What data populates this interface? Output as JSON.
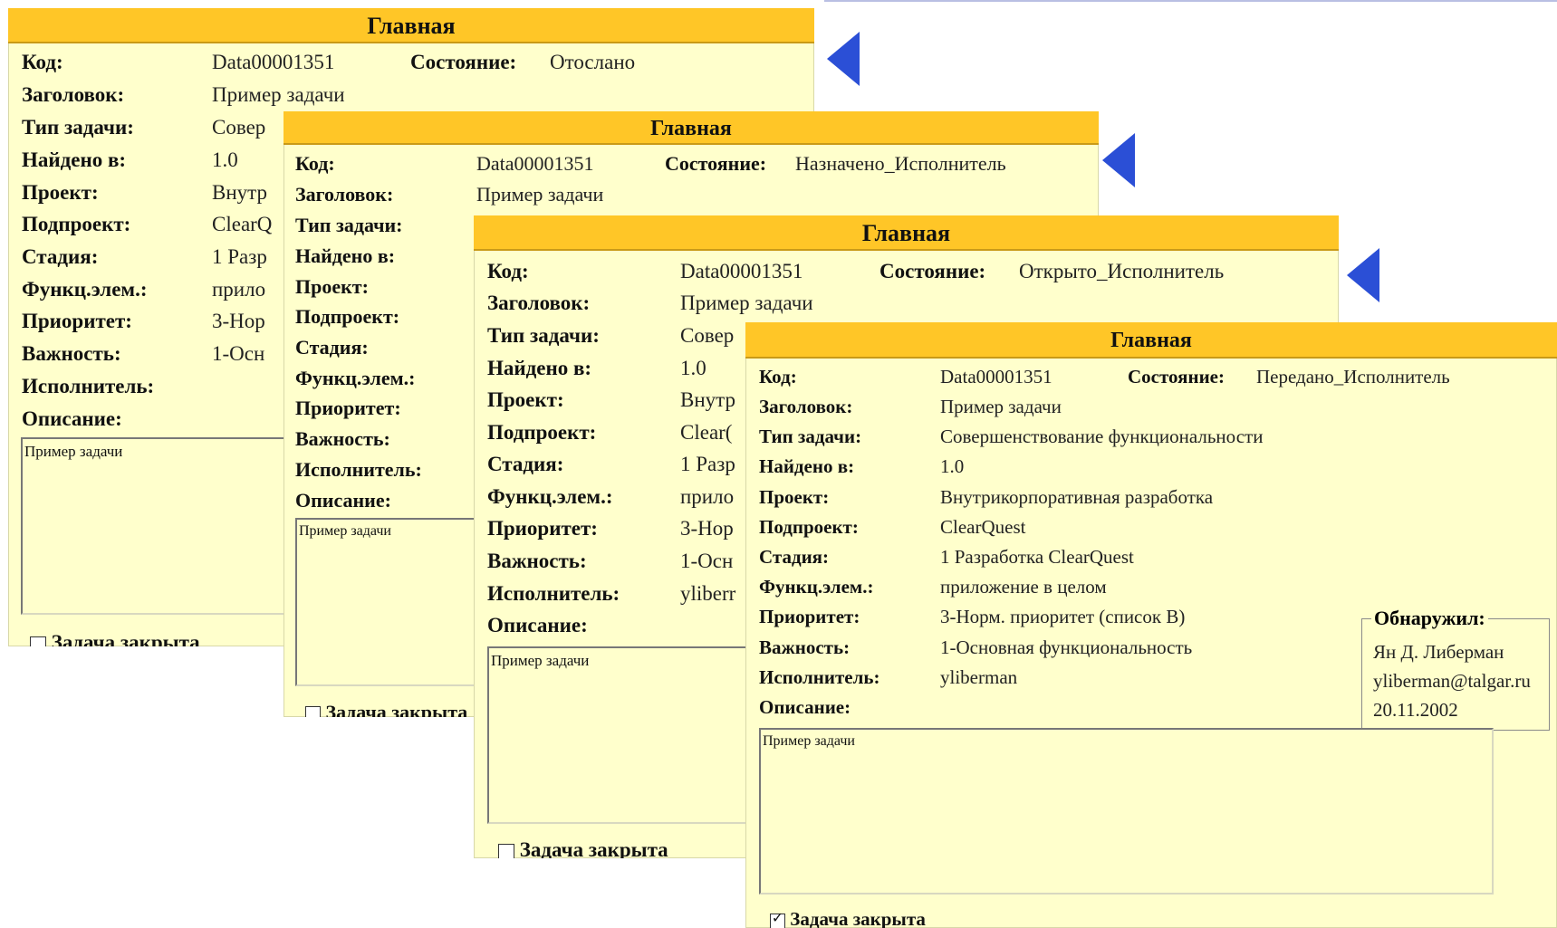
{
  "labels": {
    "title": "Главная",
    "code": "Код:",
    "state": "Состояние:",
    "headline": "Заголовок:",
    "type": "Тип задачи:",
    "found_in": "Найдено в:",
    "project": "Проект:",
    "subproject": "Подпроект:",
    "stage": "Стадия:",
    "func": "Функц.элем.:",
    "priority": "Приоритет:",
    "severity": "Важность:",
    "owner": "Исполнитель:",
    "description": "Описание:",
    "closed": "Задача закрыта",
    "found_by": "Обнаружил:"
  },
  "cards": [
    {
      "code": "Data00001351",
      "state": "Отослано",
      "headline": "Пример задачи",
      "type": "Совер",
      "found_in": "1.0",
      "project": "Внутр",
      "subproject": "ClearQ",
      "stage": "1 Разр",
      "func": "прило",
      "priority": "3-Нор",
      "severity": "1-Осн",
      "owner": "",
      "description": "Пример задачи",
      "closed": false
    },
    {
      "code": "Data00001351",
      "state": "Назначено_Исполнитель",
      "headline": "Пример задачи",
      "description": "Пример задачи",
      "closed": false
    },
    {
      "code": "Data00001351",
      "state": "Открыто_Исполнитель",
      "headline": "Пример задачи",
      "type": "Совер",
      "found_in": "1.0",
      "project": "Внутр",
      "subproject": "Clear(",
      "stage": "1 Разр",
      "func": "прило",
      "priority": "3-Нор",
      "severity": "1-Осн",
      "owner": "yliberr",
      "description": "Пример задачи",
      "closed": false
    },
    {
      "code": "Data00001351",
      "state": "Передано_Исполнитель",
      "headline": "Пример задачи",
      "type": "Совершенствование функциональности",
      "found_in": "1.0",
      "project": "Внутрикорпоративная разработка",
      "subproject": "ClearQuest",
      "stage": "1 Разработка ClearQuest",
      "func": "приложение в целом",
      "priority": "3-Норм. приоритет (список В)",
      "severity": "1-Основная функциональность",
      "owner": "yliberman",
      "description": "Пример задачи",
      "closed": true,
      "found_by": {
        "name": "Ян Д. Либерман",
        "email": "yliberman@talgar.ru",
        "date": "20.11.2002"
      }
    }
  ],
  "colors": {
    "header": "#ffc627",
    "panel": "#ffffcc",
    "arrow": "#2b4fd6"
  }
}
